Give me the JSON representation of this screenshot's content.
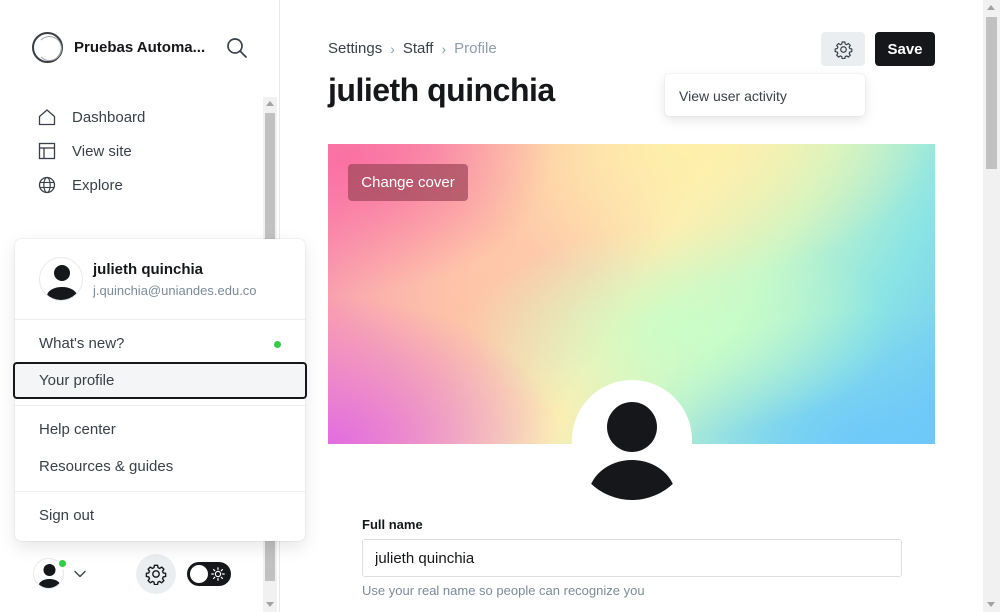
{
  "sidebar": {
    "brand_name": "Pruebas Automa...",
    "nav": [
      {
        "label": "Dashboard",
        "icon": "home-icon"
      },
      {
        "label": "View site",
        "icon": "layout-icon"
      },
      {
        "label": "Explore",
        "icon": "globe-icon"
      }
    ]
  },
  "user_menu": {
    "name": "julieth quinchia",
    "email": "j.quinchia@uniandes.edu.co",
    "items": {
      "whats_new": "What's new?",
      "your_profile": "Your profile",
      "help_center": "Help center",
      "resources": "Resources & guides",
      "sign_out": "Sign out"
    },
    "status_color": "#30cf43"
  },
  "breadcrumb": [
    "Settings",
    "Staff",
    "Profile"
  ],
  "page_title": "julieth quinchia",
  "actions": {
    "save_label": "Save",
    "dropdown_option": "View user activity"
  },
  "cover": {
    "change_label": "Change cover"
  },
  "form": {
    "full_name_label": "Full name",
    "full_name_value": "julieth quinchia",
    "full_name_hint": "Use your real name so people can recognize you"
  },
  "colors": {
    "accent_dark": "#15171a",
    "online": "#30cf43"
  }
}
